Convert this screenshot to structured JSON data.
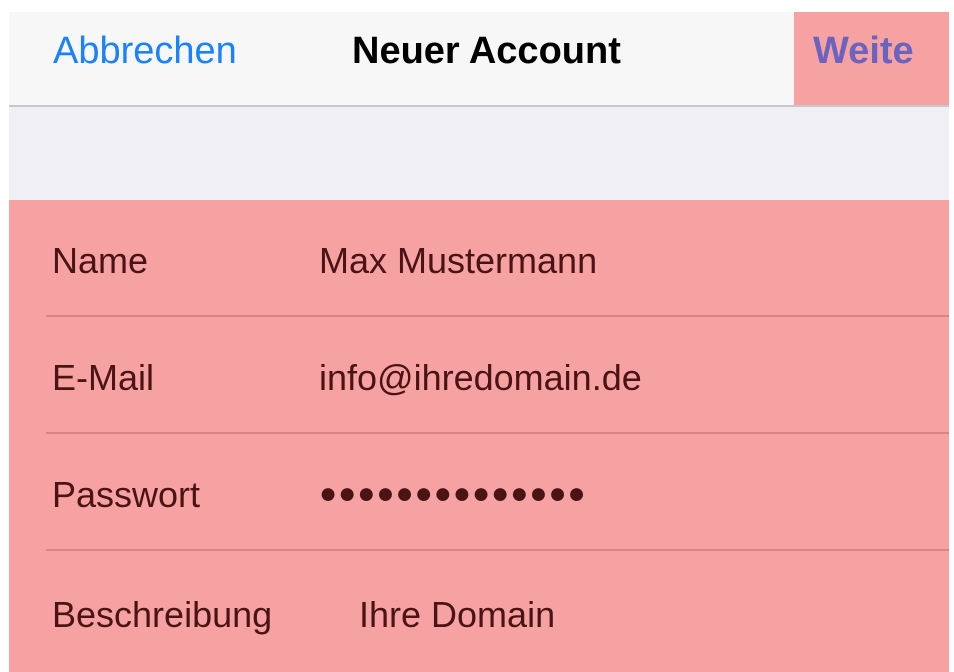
{
  "navbar": {
    "cancel_label": "Abbrechen",
    "title": "Neuer Account",
    "next_label": "Weite"
  },
  "form": {
    "rows": [
      {
        "label": "Name",
        "value": "Max Mustermann"
      },
      {
        "label": "E-Mail",
        "value": "info@ihredomain.de"
      },
      {
        "label": "Passwort",
        "value": "●●●●●●●●●●●●●●"
      },
      {
        "label": "Beschreibung",
        "value": "Ihre Domain"
      }
    ]
  },
  "colors": {
    "accent": "#1a82fb",
    "highlight": "#f6a2a3",
    "next_text": "#6a64bf"
  }
}
